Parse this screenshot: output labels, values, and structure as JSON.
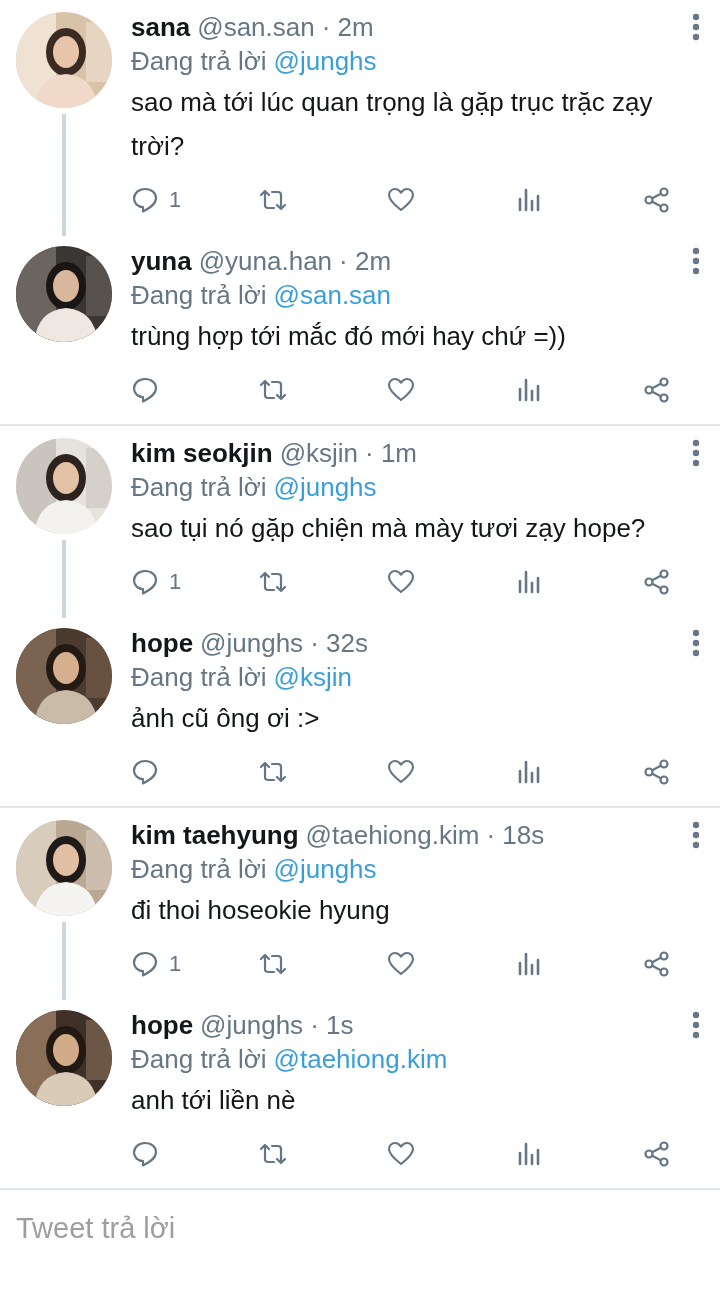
{
  "threads": [
    {
      "tweets": [
        {
          "name": "sana",
          "handle": "@san.san",
          "time": "· 2m",
          "reply_prefix": "Đang trả lời",
          "reply_to": "@junghs",
          "text": "sao mà tới lúc quan trọng là gặp trục trặc zạy trời?",
          "reply_count": "1"
        },
        {
          "name": "yuna",
          "handle": "@yuna.han",
          "time": "· 2m",
          "reply_prefix": "Đang trả lời",
          "reply_to": "@san.san",
          "text": "trùng hợp tới mắc đó mới hay chứ =))"
        }
      ]
    },
    {
      "tweets": [
        {
          "name": "kim seokjin",
          "handle": "@ksjin",
          "time": "· 1m",
          "reply_prefix": "Đang trả lời",
          "reply_to": "@junghs",
          "text": "sao tụi nó gặp chiện mà mày tươi zạy hope?",
          "reply_count": "1"
        },
        {
          "name": "hope",
          "handle": "@junghs",
          "time": "· 32s",
          "reply_prefix": "Đang trả lời",
          "reply_to": "@ksjin",
          "text": "ảnh cũ ông ơi :>"
        }
      ]
    },
    {
      "tweets": [
        {
          "name": "kim taehyung",
          "handle": "@taehiong.kim",
          "time": "· 18s",
          "reply_prefix": "Đang trả lời",
          "reply_to": "@junghs",
          "text": "đi thoi hoseokie hyung",
          "reply_count": "1"
        },
        {
          "name": "hope",
          "handle": "@junghs",
          "time": "· 1s",
          "reply_prefix": "Đang trả lời",
          "reply_to": "@taehiong.kim",
          "text": "anh tới liền nè"
        }
      ]
    }
  ],
  "reply_box": {
    "placeholder": "Tweet trả lời"
  }
}
